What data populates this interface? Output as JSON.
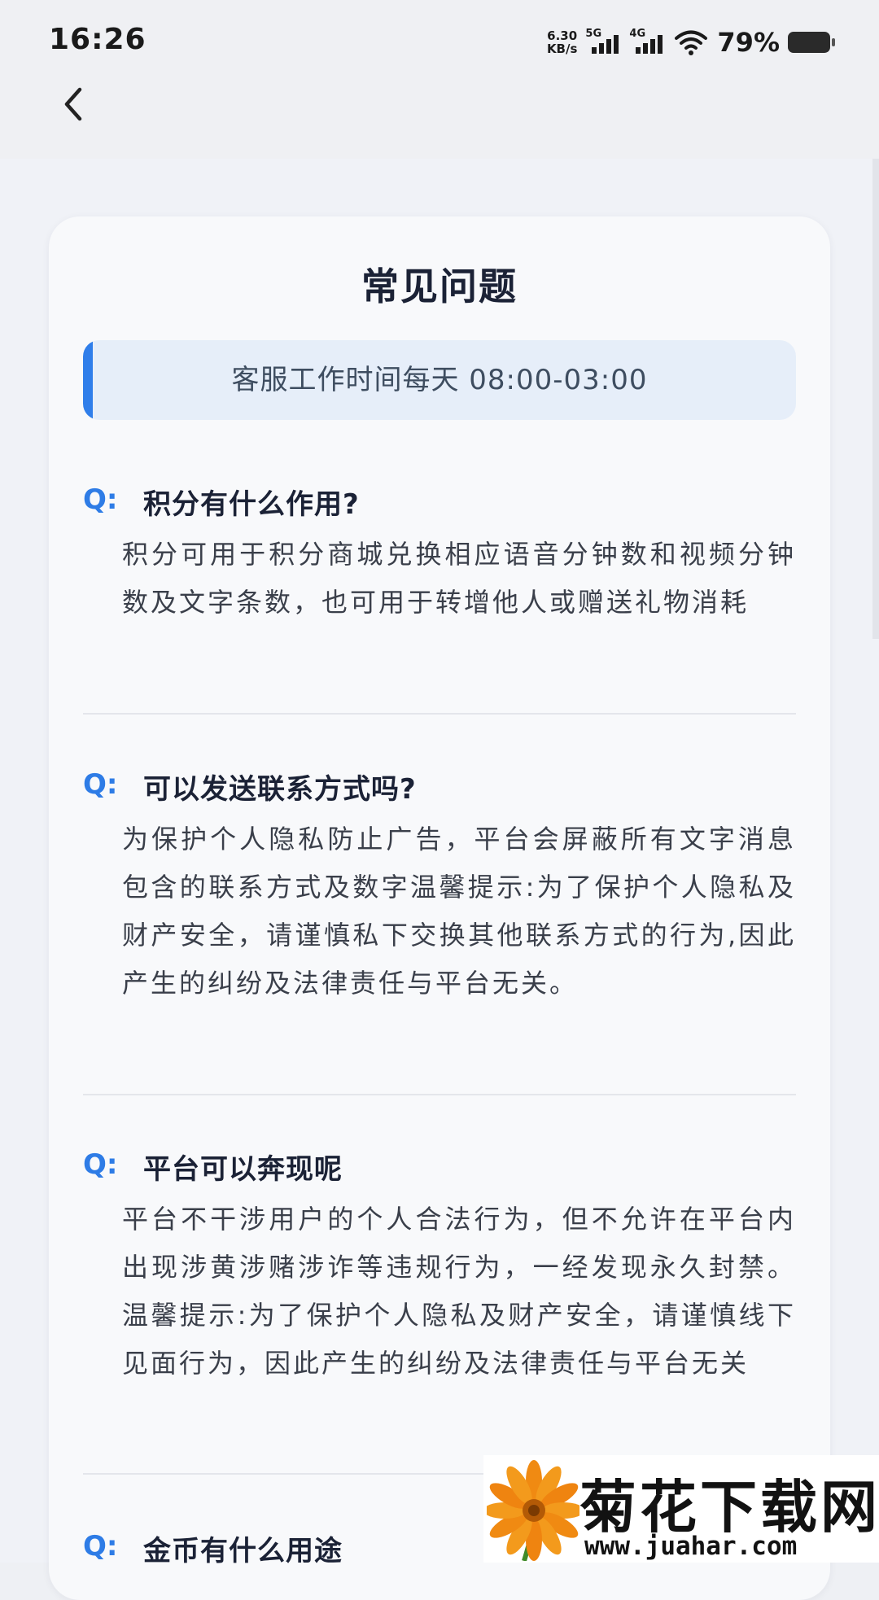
{
  "status_bar": {
    "time": "16:26",
    "net_speed_value": "6.30",
    "net_speed_unit": "KB/s",
    "signal1_label": "5G",
    "signal2_label": "4G",
    "battery_percent": "79%",
    "icons": [
      "signal-icon",
      "signal-icon",
      "wifi-icon",
      "battery-icon"
    ]
  },
  "header": {
    "back_icon": "chevron-left-icon"
  },
  "card": {
    "title": "常见问题",
    "service_hours": "客服工作时间每天 08:00-03:00",
    "faqs": [
      {
        "q_mark": "Q:",
        "question": "积分有什么作用?",
        "answer": "积分可用于积分商城兑换相应语音分钟数和视频分钟数及文字条数，也可用于转增他人或赠送礼物消耗"
      },
      {
        "q_mark": "Q:",
        "question": "可以发送联系方式吗?",
        "answer": "为保护个人隐私防止广告，平台会屏蔽所有文字消息包含的联系方式及数字温馨提示:为了保护个人隐私及财产安全，请谨慎私下交换其他联系方式的行为,因此产生的纠纷及法律责任与平台无关。"
      },
      {
        "q_mark": "Q:",
        "question": "平台可以奔现呢",
        "answer": "平台不干涉用户的个人合法行为，但不允许在平台内出现涉黄涉赌涉诈等违规行为，一经发现永久封禁。温馨提示:为了保护个人隐私及财产安全，请谨慎线下见面行为，因此产生的纠纷及法律责任与平台无关"
      },
      {
        "q_mark": "Q:",
        "question": "金币有什么用途",
        "answer": ""
      }
    ]
  },
  "watermark": {
    "title": "菊花下载网",
    "url": "www.juahar.com",
    "flower_icon": "flower-icon"
  },
  "colors": {
    "accent": "#2e7ce6",
    "banner_bg": "#e6eef9",
    "text_dark": "#1b2236",
    "text_body": "#3a3f4a"
  }
}
